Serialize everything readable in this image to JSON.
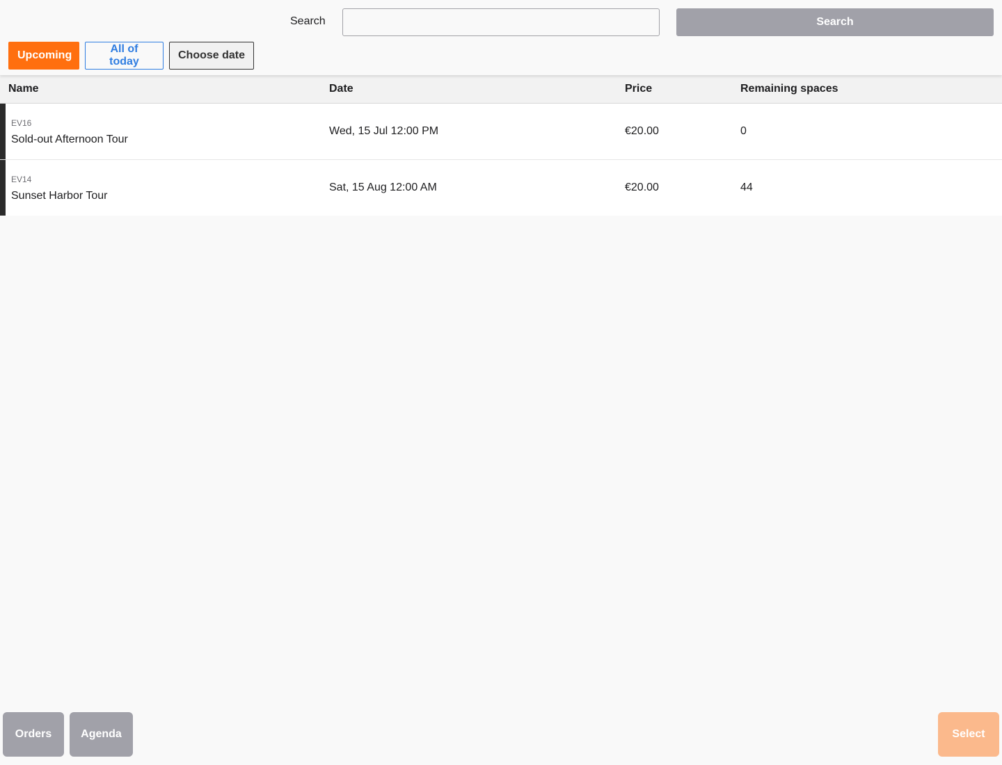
{
  "header": {
    "search_label": "Search",
    "search_value": "",
    "search_placeholder": "",
    "search_button_label": "Search"
  },
  "filters": {
    "upcoming_label": "Upcoming",
    "today_label": "All of today",
    "choose_date_label": "Choose date",
    "active": "Upcoming"
  },
  "table": {
    "columns": {
      "name": "Name",
      "date": "Date",
      "price": "Price",
      "remaining": "Remaining spaces"
    },
    "rows": [
      {
        "code": "EV16",
        "name": "Sold-out Afternoon Tour",
        "date": "Wed, 15 Jul 12:00 PM",
        "price": "€20.00",
        "remaining": "0"
      },
      {
        "code": "EV14",
        "name": "Sunset Harbor Tour",
        "date": "Sat, 15 Aug 12:00 AM",
        "price": "€20.00",
        "remaining": "44"
      }
    ]
  },
  "footer": {
    "orders_label": "Orders",
    "agenda_label": "Agenda",
    "select_label": "Select"
  },
  "colors": {
    "accent": "#ff6f0f",
    "link": "#2f7de1",
    "neutral_button": "#a1a1a9",
    "select_disabled": "#fbb98c"
  }
}
